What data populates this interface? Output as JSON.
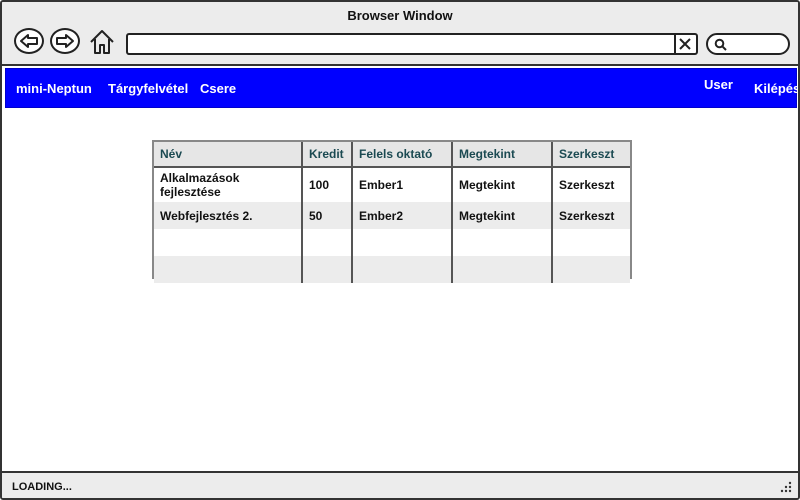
{
  "window": {
    "title": "Browser Window"
  },
  "toolbar": {
    "address_value": "",
    "search_value": ""
  },
  "nav": {
    "left_items": [
      "mini-Neptun",
      "Tárgyfelvétel",
      "Csere"
    ],
    "right_items": [
      "User",
      "Kilépés"
    ]
  },
  "table": {
    "headers": [
      "Név",
      "Kredit",
      "Felels oktató",
      "Megtekint",
      "Szerkeszt"
    ],
    "rows": [
      [
        "Alkalmazások fejlesztése",
        "100",
        "Ember1",
        "Megtekint",
        "Szerkeszt"
      ],
      [
        "Webfejlesztés 2.",
        "50",
        "Ember2",
        "Megtekint",
        "Szerkeszt"
      ],
      [
        "",
        "",
        "",
        "",
        ""
      ],
      [
        "",
        "",
        "",
        "",
        ""
      ]
    ]
  },
  "status": {
    "text": "LOADING..."
  },
  "colors": {
    "nav_bg": "#0000ff",
    "header_text": "#1b4a52",
    "chrome_bg": "#ececec"
  }
}
